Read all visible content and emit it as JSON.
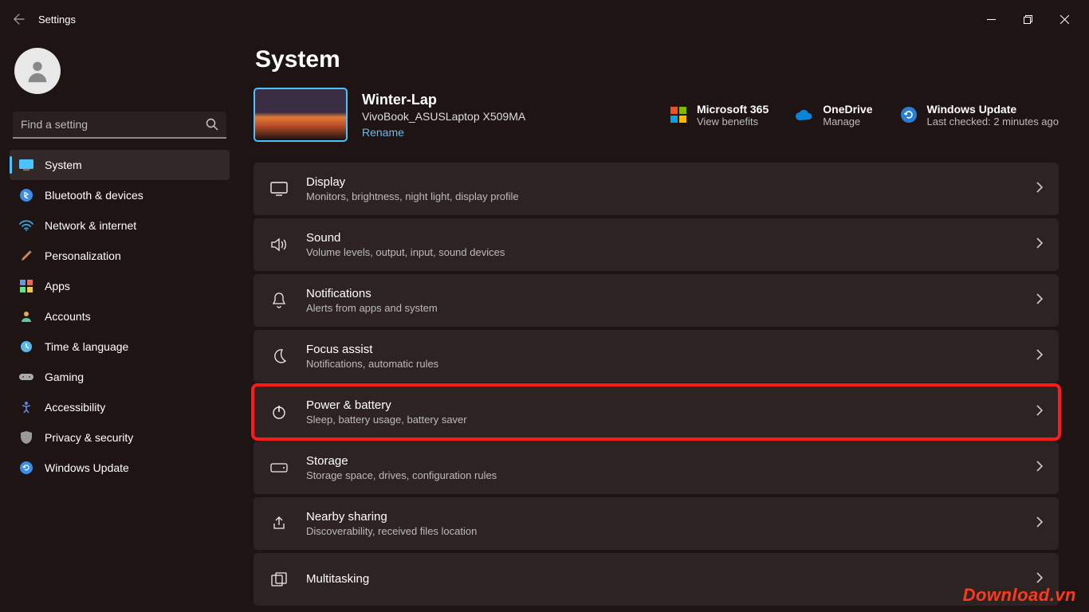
{
  "window": {
    "title": "Settings"
  },
  "user": {
    "name": "",
    "email": ""
  },
  "search": {
    "placeholder": "Find a setting"
  },
  "sidebar": {
    "items": [
      {
        "label": "System"
      },
      {
        "label": "Bluetooth & devices"
      },
      {
        "label": "Network & internet"
      },
      {
        "label": "Personalization"
      },
      {
        "label": "Apps"
      },
      {
        "label": "Accounts"
      },
      {
        "label": "Time & language"
      },
      {
        "label": "Gaming"
      },
      {
        "label": "Accessibility"
      },
      {
        "label": "Privacy & security"
      },
      {
        "label": "Windows Update"
      }
    ]
  },
  "page": {
    "title": "System"
  },
  "device": {
    "name": "Winter-Lap",
    "model": "VivoBook_ASUSLaptop X509MA",
    "rename": "Rename"
  },
  "quicklinks": {
    "m365": {
      "title": "Microsoft 365",
      "sub": "View benefits"
    },
    "onedrive": {
      "title": "OneDrive",
      "sub": "Manage"
    },
    "update": {
      "title": "Windows Update",
      "sub": "Last checked: 2 minutes ago"
    }
  },
  "cards": [
    {
      "title": "Display",
      "sub": "Monitors, brightness, night light, display profile"
    },
    {
      "title": "Sound",
      "sub": "Volume levels, output, input, sound devices"
    },
    {
      "title": "Notifications",
      "sub": "Alerts from apps and system"
    },
    {
      "title": "Focus assist",
      "sub": "Notifications, automatic rules"
    },
    {
      "title": "Power & battery",
      "sub": "Sleep, battery usage, battery saver"
    },
    {
      "title": "Storage",
      "sub": "Storage space, drives, configuration rules"
    },
    {
      "title": "Nearby sharing",
      "sub": "Discoverability, received files location"
    },
    {
      "title": "Multitasking",
      "sub": ""
    }
  ],
  "watermark": "Download.vn"
}
